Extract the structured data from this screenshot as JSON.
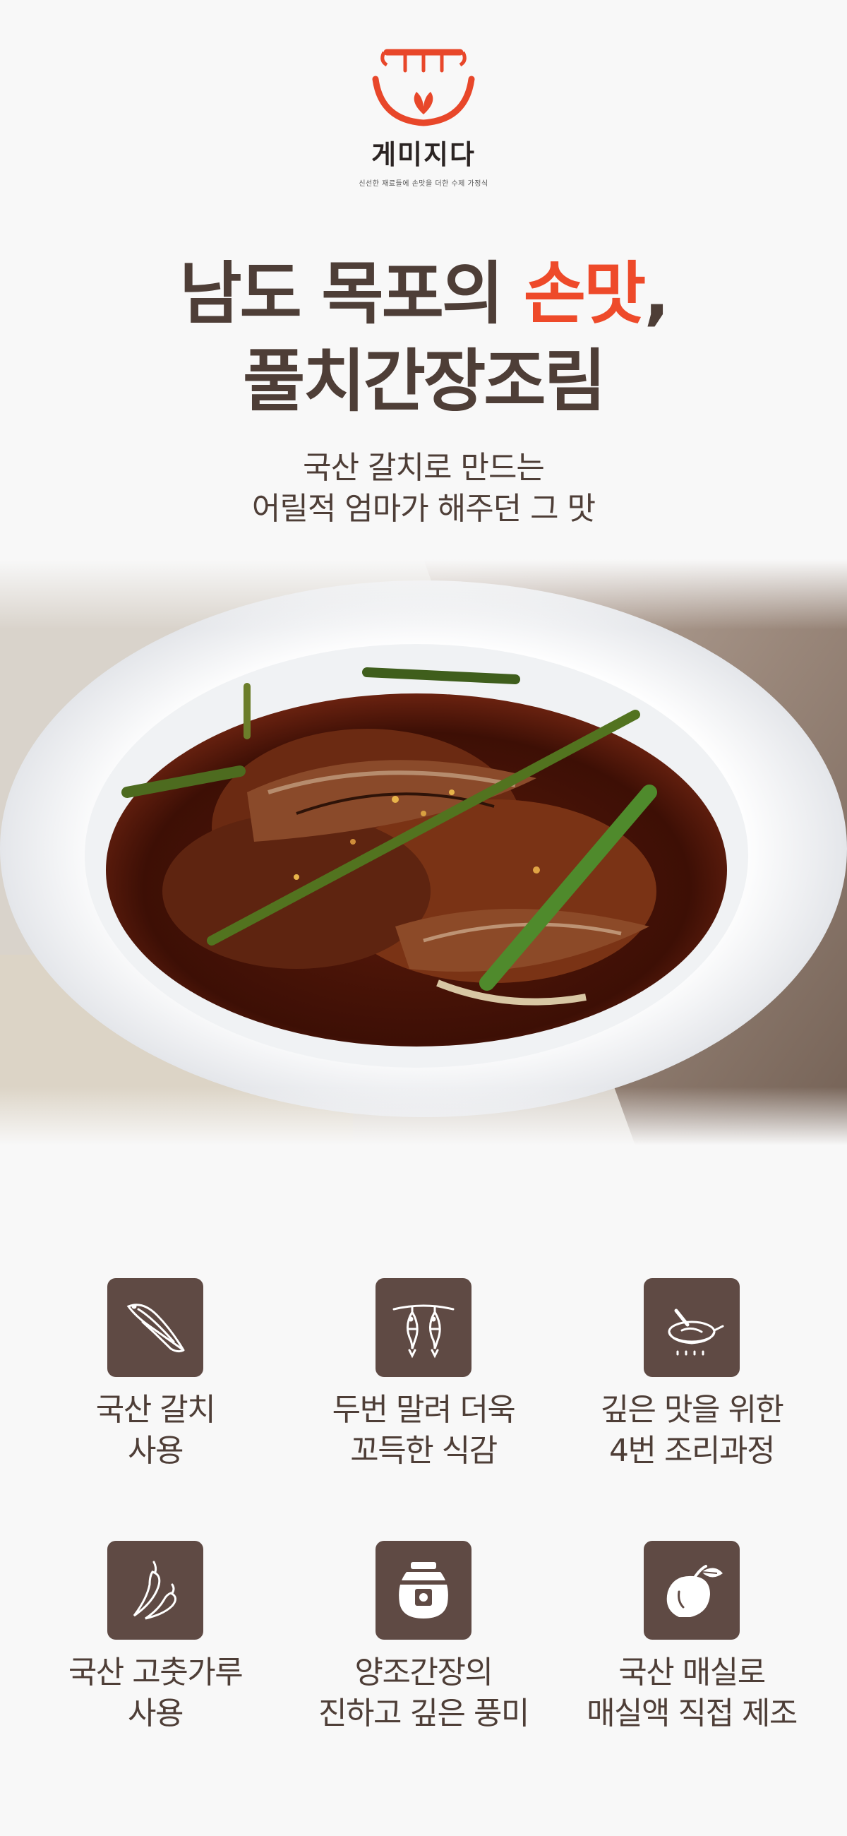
{
  "brand": {
    "name": "게미지다",
    "tagline": "신선한 재료들에 손맛을 더한 수제 가정식",
    "logo_icon": "pot-with-leaf-icon",
    "colors": {
      "accent": "#ee4a2a",
      "text": "#4e3e37",
      "icon_bg": "#5f4a44"
    }
  },
  "hero": {
    "title_line1_prefix": "남도 목포의 ",
    "title_line1_accent": "손맛",
    "title_line1_suffix": ",",
    "title_line2": "풀치간장조림",
    "subtitle_line1": "국산 갈치로 만드는",
    "subtitle_line2": "어릴적 엄마가 해주던 그 맛"
  },
  "photo": {
    "icon": "braised-fish-dish-photo"
  },
  "features": [
    {
      "icon": "hairtail-fish-icon",
      "line1": "국산 갈치",
      "line2": "사용"
    },
    {
      "icon": "drying-fish-icon",
      "line1": "두번 말려 더욱",
      "line2": "꼬득한 식감"
    },
    {
      "icon": "frying-pan-icon",
      "line1": "깊은 맛을 위한",
      "line2": "4번 조리과정"
    },
    {
      "icon": "chili-pepper-icon",
      "line1": "국산 고춧가루",
      "line2": "사용"
    },
    {
      "icon": "soy-sauce-jar-icon",
      "line1": "양조간장의",
      "line2": "진하고 깊은 풍미"
    },
    {
      "icon": "plum-icon",
      "line1": "국산 매실로",
      "line2": "매실액 직접 제조"
    }
  ]
}
